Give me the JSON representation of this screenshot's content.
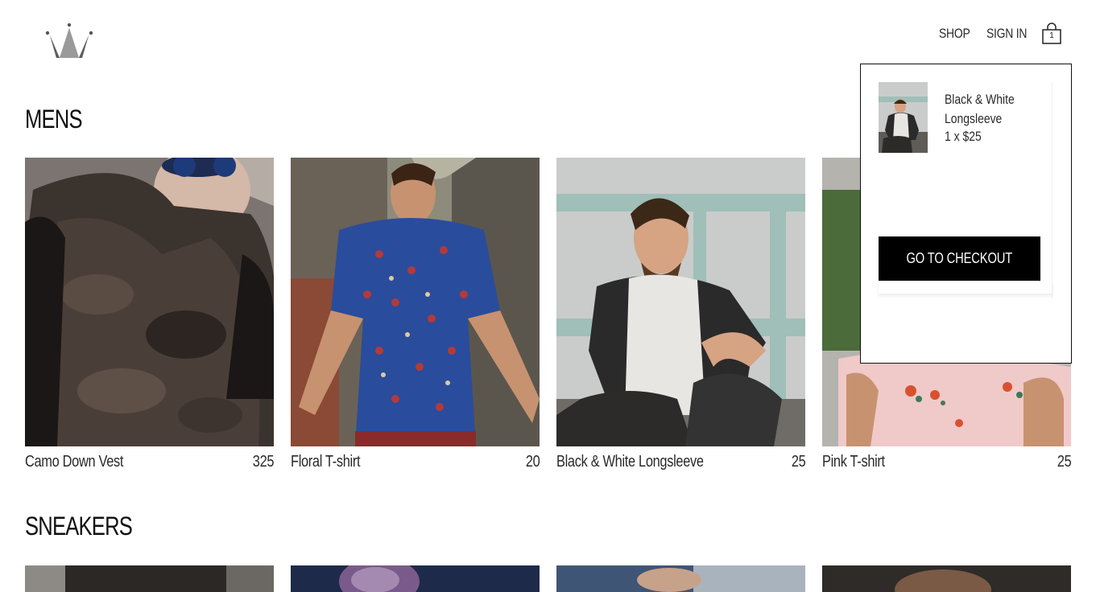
{
  "header": {
    "logo_icon": "crown-icon",
    "nav": {
      "shop_label": "SHOP",
      "signin_label": "SIGN IN"
    },
    "cart": {
      "icon": "shopping-bag-icon",
      "count": "1"
    }
  },
  "sections": [
    {
      "title": "MENS",
      "items": [
        {
          "name": "Camo Down Vest",
          "price": "325"
        },
        {
          "name": "Floral T-shirt",
          "price": "20"
        },
        {
          "name": "Black & White Longsleeve",
          "price": "25"
        },
        {
          "name": "Pink T-shirt",
          "price": "25"
        }
      ]
    },
    {
      "title": "SNEAKERS"
    }
  ],
  "cart_dropdown": {
    "items": [
      {
        "name": "Black & White Longsleeve",
        "quantity_price": "1 x $25"
      }
    ],
    "checkout_label": "GO TO CHECKOUT"
  },
  "colors": {
    "accent": "#000000",
    "text": "#2a2a2a",
    "background": "#ffffff"
  }
}
